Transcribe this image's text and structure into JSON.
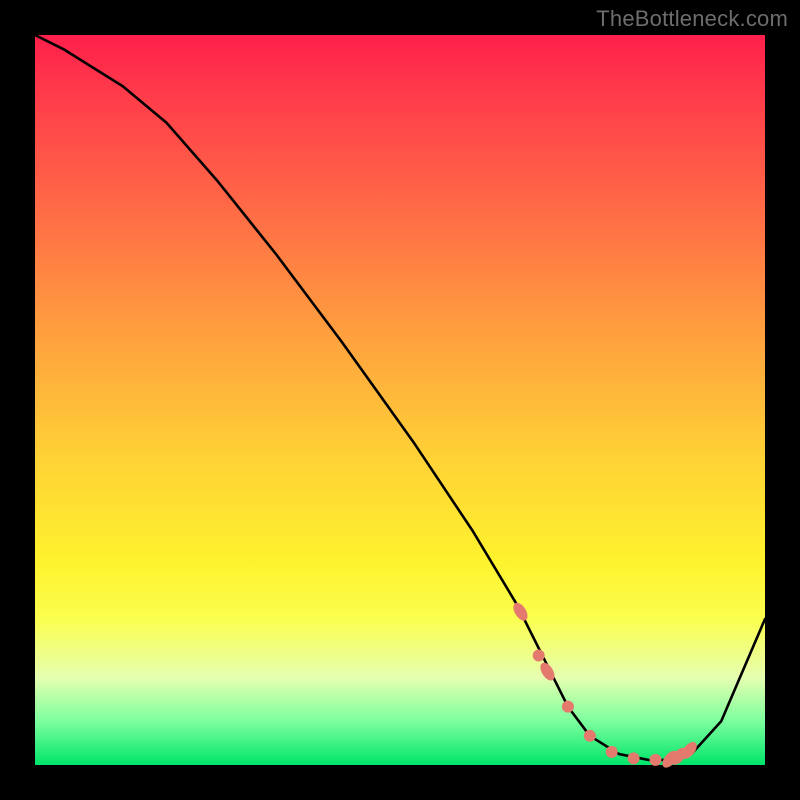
{
  "watermark": "TheBottleneck.com",
  "chart_data": {
    "type": "line",
    "title": "",
    "xlabel": "",
    "ylabel": "",
    "xlim": [
      0,
      100
    ],
    "ylim": [
      0,
      100
    ],
    "grid": false,
    "legend": false,
    "series": [
      {
        "name": "bottleneck-curve",
        "x": [
          0,
          4,
          8,
          12,
          18,
          25,
          33,
          42,
          52,
          60,
          66,
          70,
          73,
          76,
          80,
          84,
          87,
          90,
          94,
          100
        ],
        "y": [
          100,
          98,
          95.5,
          93,
          88,
          80,
          70,
          58,
          44,
          32,
          22,
          14,
          8,
          4,
          1.5,
          0.7,
          0.7,
          1.6,
          6,
          20
        ]
      }
    ],
    "markers": {
      "name": "highlight-dots",
      "x": [
        66.5,
        69,
        70.2,
        73,
        76,
        79,
        82,
        85,
        87,
        88.2,
        89.6
      ],
      "y": [
        21,
        15,
        12.8,
        8,
        4,
        1.8,
        0.9,
        0.7,
        0.8,
        1.2,
        2.0
      ],
      "elongated": [
        true,
        false,
        true,
        false,
        false,
        false,
        false,
        false,
        true,
        true,
        true
      ]
    },
    "colors": {
      "curve": "#000000",
      "marker": "#e47a6e",
      "gradient_top": "#ff1f4b",
      "gradient_bottom": "#00e46a"
    }
  }
}
